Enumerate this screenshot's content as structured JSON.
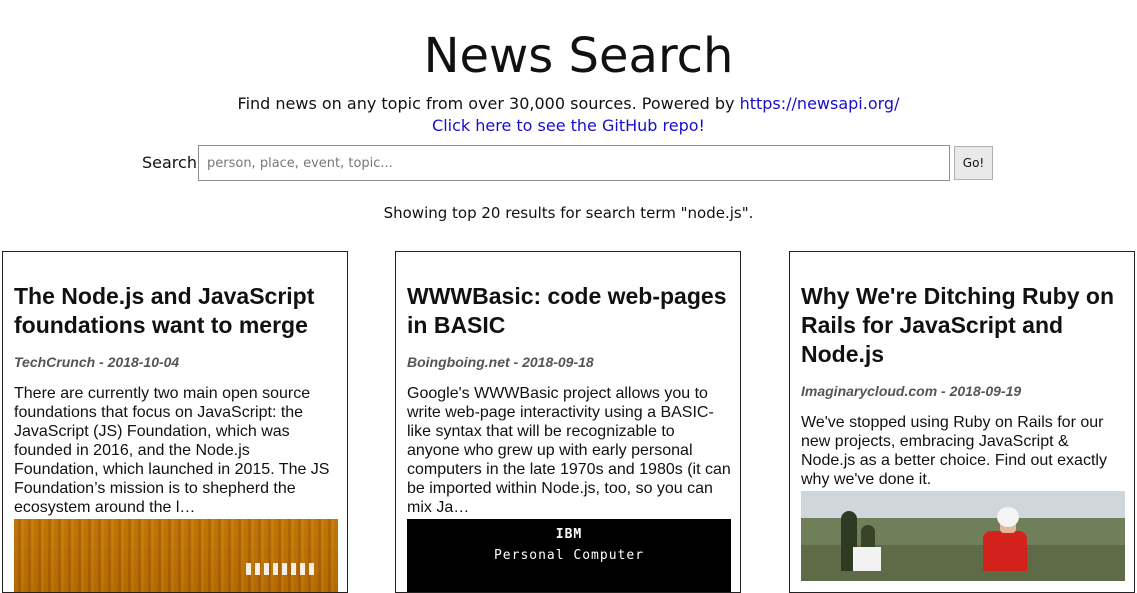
{
  "header": {
    "title": "News Search",
    "subtitle_text": "Find news on any topic from over 30,000 sources. Powered by ",
    "subtitle_link": "https://newsapi.org/",
    "repo_link": "Click here to see the GitHub repo!"
  },
  "search": {
    "label": "Search:",
    "placeholder": "person, place, event, topic...",
    "value": "",
    "button_label": "Go!"
  },
  "results_summary": "Showing top 20 results for search term \"node.js\".",
  "articles": [
    {
      "title": "The Node.js and JavaScript foundations want to merge",
      "meta": "TechCrunch - 2018-10-04",
      "description": "There are currently two main open source foundations that focus on JavaScript: the JavaScript (JS) Foundation, which was founded in 2016, and the Node.js Foundation, which launched in 2015. The JS Foundation’s mission is to shepherd the ecosystem around the l…"
    },
    {
      "title": "WWWBasic: code web-pages in BASIC",
      "meta": "Boingboing.net - 2018-09-18",
      "description": "Google's WWWBasic project allows you to write web-page interactivity using a BASIC-like syntax that will be recognizable to anyone who grew up with early personal computers in the late 1970s and 1980s (it can be imported within Node.js, too, so you can mix Ja…",
      "image_text": [
        "IBM",
        "Personal Computer"
      ]
    },
    {
      "title": "Why We're Ditching Ruby on Rails for JavaScript and Node.js",
      "meta": "Imaginarycloud.com - 2018-09-19",
      "description": "We've stopped using Ruby on Rails for our new projects, embracing JavaScript & Node.js as a better choice. Find out exactly why we've done it."
    }
  ],
  "colors": {
    "link": "#1a0dcc",
    "meta": "#555555",
    "border": "#222222"
  }
}
